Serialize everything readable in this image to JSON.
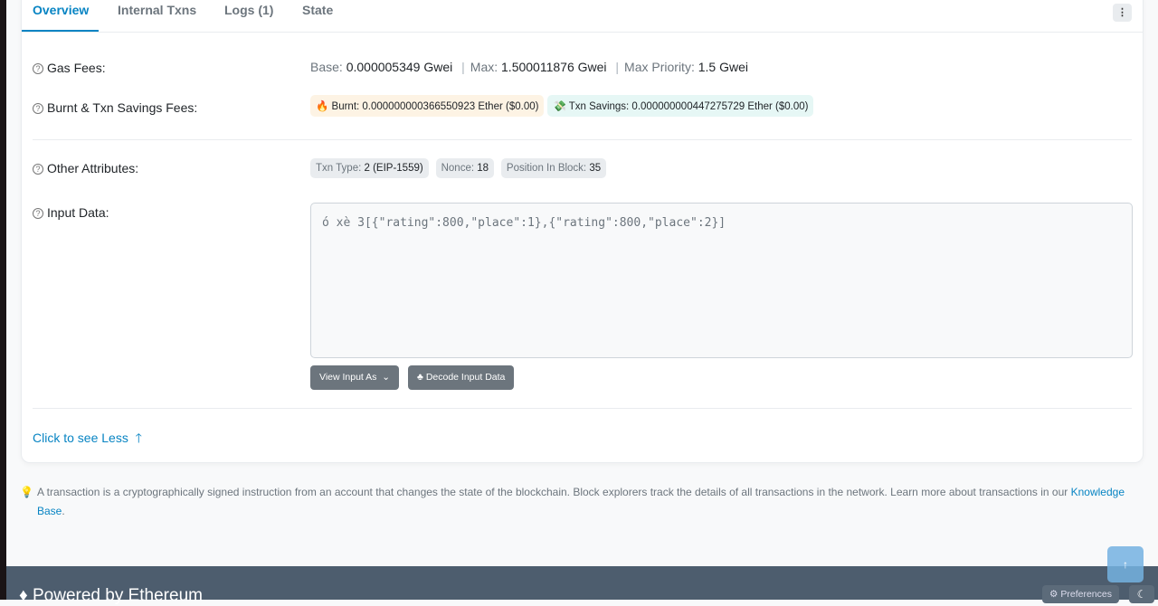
{
  "tabs": [
    {
      "label": "Overview",
      "active": true
    },
    {
      "label": "Internal Txns"
    },
    {
      "label": "Logs (1)"
    },
    {
      "label": "State"
    }
  ],
  "menu_icon": "more-vertical-icon",
  "gas_fees": {
    "label": "Gas Fees:",
    "base_label": "Base:",
    "base": "0.000005349 Gwei",
    "max_label": "Max:",
    "max": "1.500011876 Gwei",
    "max_priority_label": "Max Priority:",
    "max_priority": "1.5 Gwei"
  },
  "burnt_fees": {
    "label": "Burnt & Txn Savings Fees:",
    "burnt": "Burnt: 0.000000000366550923 Ether ($0.00)",
    "savings": "Txn Savings: 0.000000000447275729 Ether ($0.00)"
  },
  "other_attributes": {
    "label": "Other Attributes:",
    "txn_type_label": "Txn Type:",
    "txn_type": "2 (EIP-1559)",
    "nonce_label": "Nonce:",
    "nonce": "18",
    "position_label": "Position In Block:",
    "position": "35"
  },
  "input_data": {
    "label": "Input Data:",
    "value": "ó xè 3[{\"rating\":800,\"place\":1},{\"rating\":800,\"place\":2}]",
    "view_as": "View Input As",
    "decode": "Decode Input Data"
  },
  "see_less": "Click to see Less",
  "note": {
    "text": "A transaction is a cryptographically signed instruction from an account that changes the state of the blockchain. Block explorers track the details of all transactions in the network. Learn more about transactions in our ",
    "link": "Knowledge Base",
    "end": "."
  },
  "footer": {
    "powered": "Powered by Ethereum",
    "preferences": "Preferences"
  },
  "colors": {
    "accent": "#0784c3",
    "footer": "#4d5d6e"
  }
}
